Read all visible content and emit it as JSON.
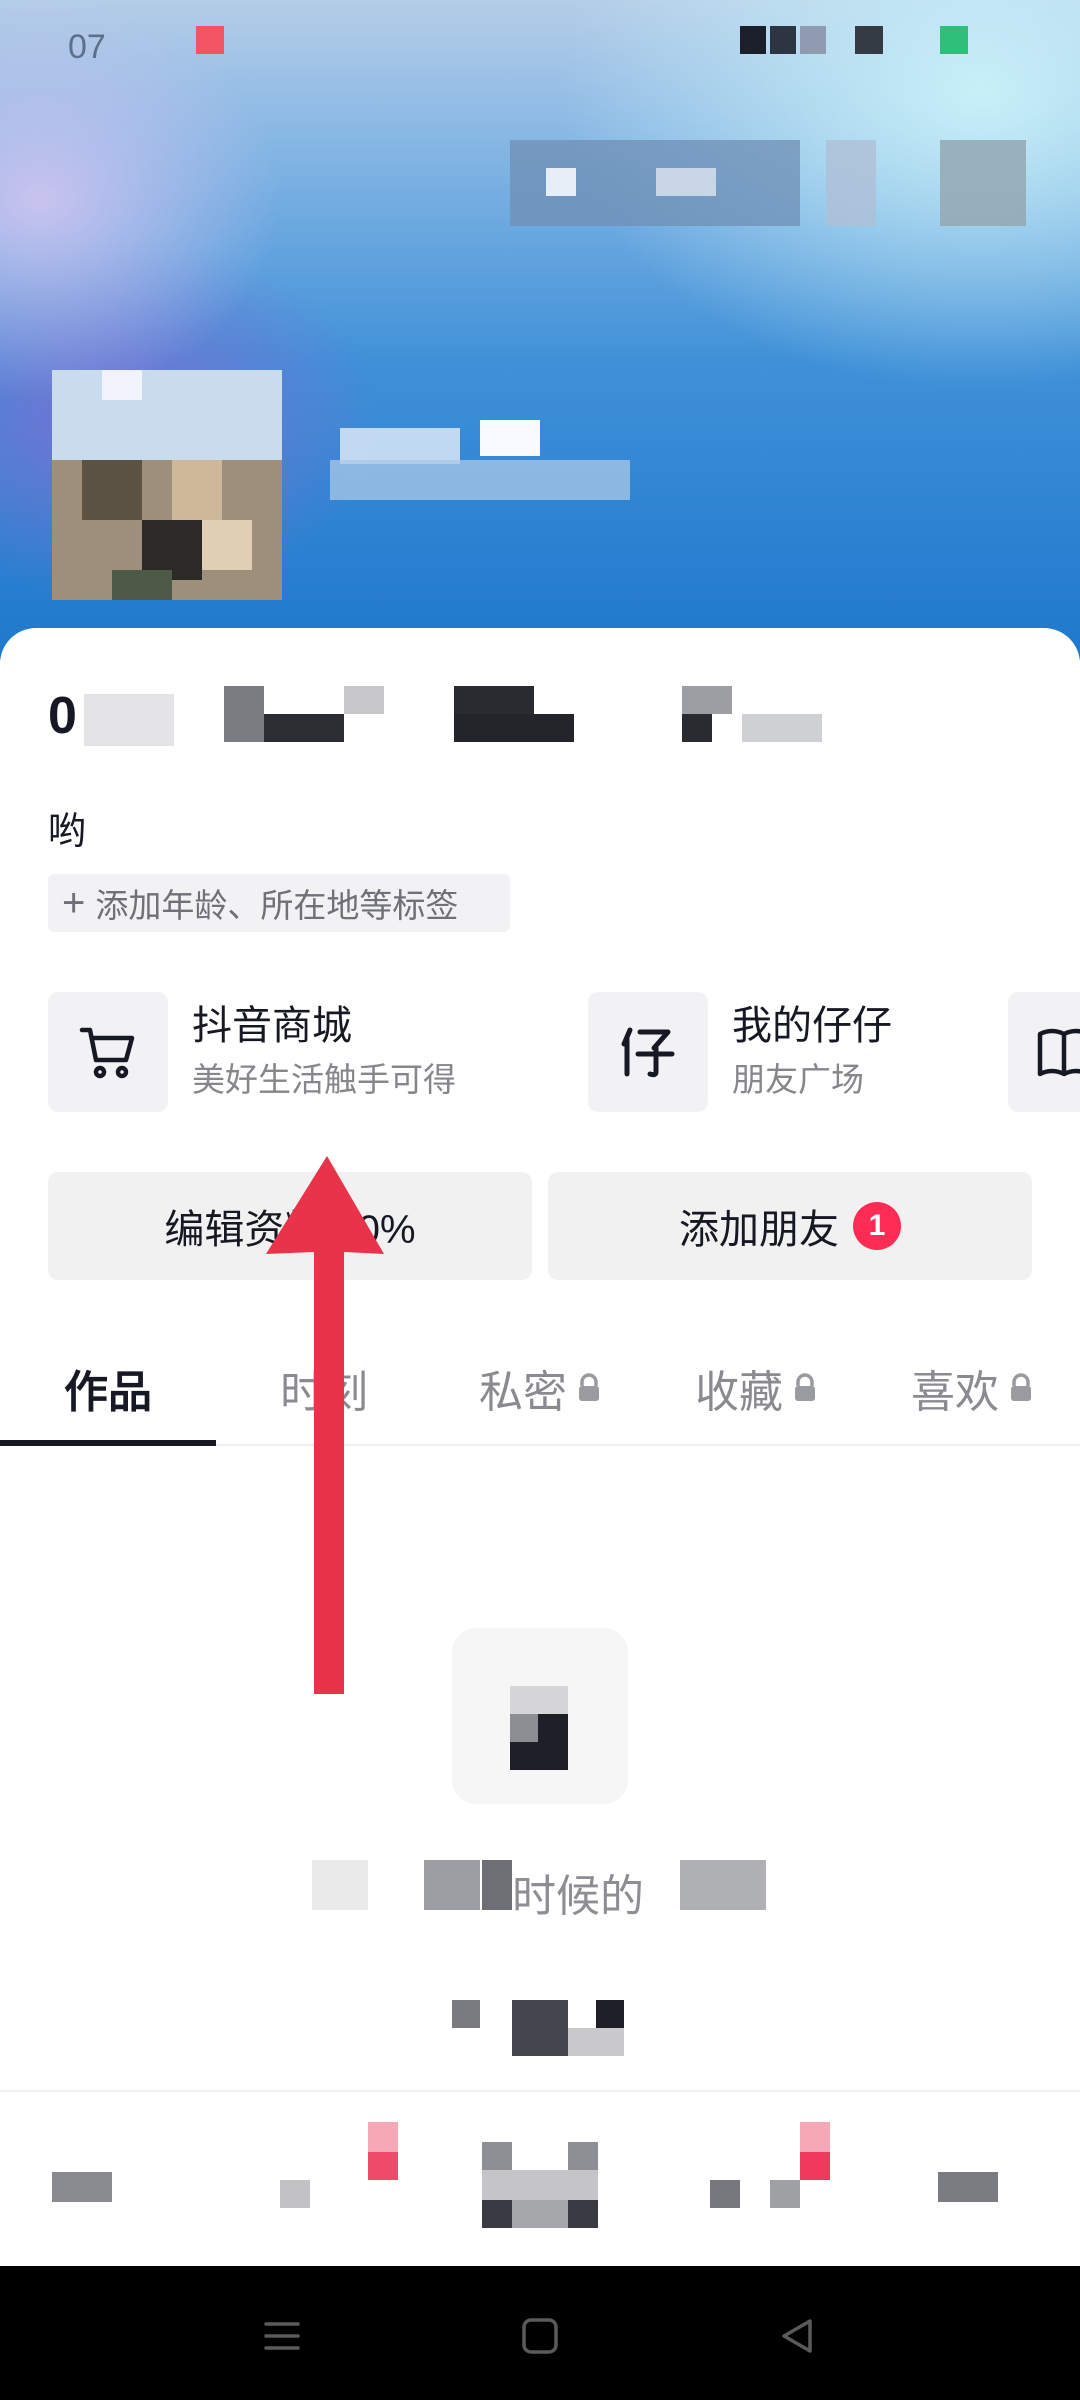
{
  "status_bar": {
    "time": "07"
  },
  "profile": {
    "stats_prefix": "0",
    "bio": "哟",
    "add_tags_label": "添加年龄、所在地等标签"
  },
  "features": [
    {
      "title": "抖音商城",
      "subtitle": "美好生活触手可得",
      "icon": "shopping-cart-icon"
    },
    {
      "title": "我的仔仔",
      "subtitle": "朋友广场",
      "icon": "zaizai-icon"
    },
    {
      "title": "",
      "subtitle": "",
      "icon": "book-icon"
    }
  ],
  "actions": {
    "edit_profile": "编辑资料 60%",
    "add_friends": "添加朋友",
    "add_friends_badge": "1"
  },
  "tabs": [
    {
      "label": "作品",
      "locked": false,
      "active": true
    },
    {
      "label": "时刻",
      "locked": false,
      "active": false
    },
    {
      "label": "私密",
      "locked": true,
      "active": false
    },
    {
      "label": "收藏",
      "locked": true,
      "active": false
    },
    {
      "label": "喜欢",
      "locked": true,
      "active": false
    }
  ],
  "empty_state": {
    "text": "时候的"
  },
  "colors": {
    "accent": "#fe2c55",
    "annotation_arrow": "#e8334a"
  },
  "system_nav": [
    "menu-icon",
    "home-icon",
    "back-icon"
  ]
}
